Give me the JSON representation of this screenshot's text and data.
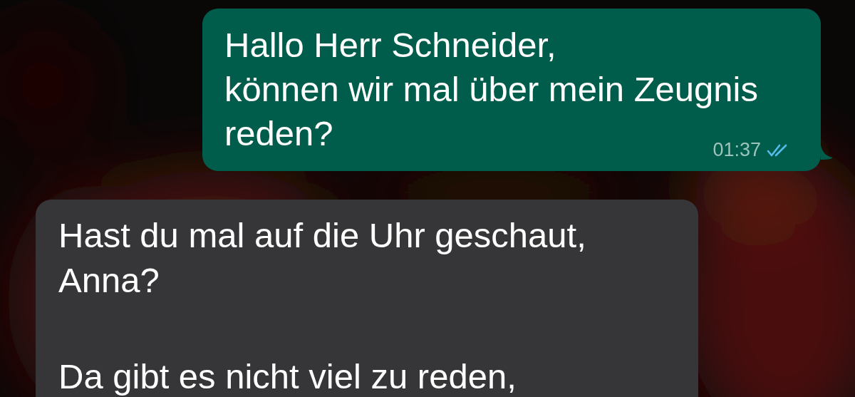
{
  "messages": [
    {
      "kind": "outgoing",
      "lines": [
        "Hallo Herr Schneider,",
        "können wir mal über mein Zeugnis",
        "reden?"
      ],
      "time": "01:37",
      "read": true
    },
    {
      "kind": "incoming",
      "paragraphs": [
        "Hast du mal auf die Uhr geschaut,\nAnna?",
        "Da gibt es nicht viel zu reden,"
      ]
    }
  ]
}
